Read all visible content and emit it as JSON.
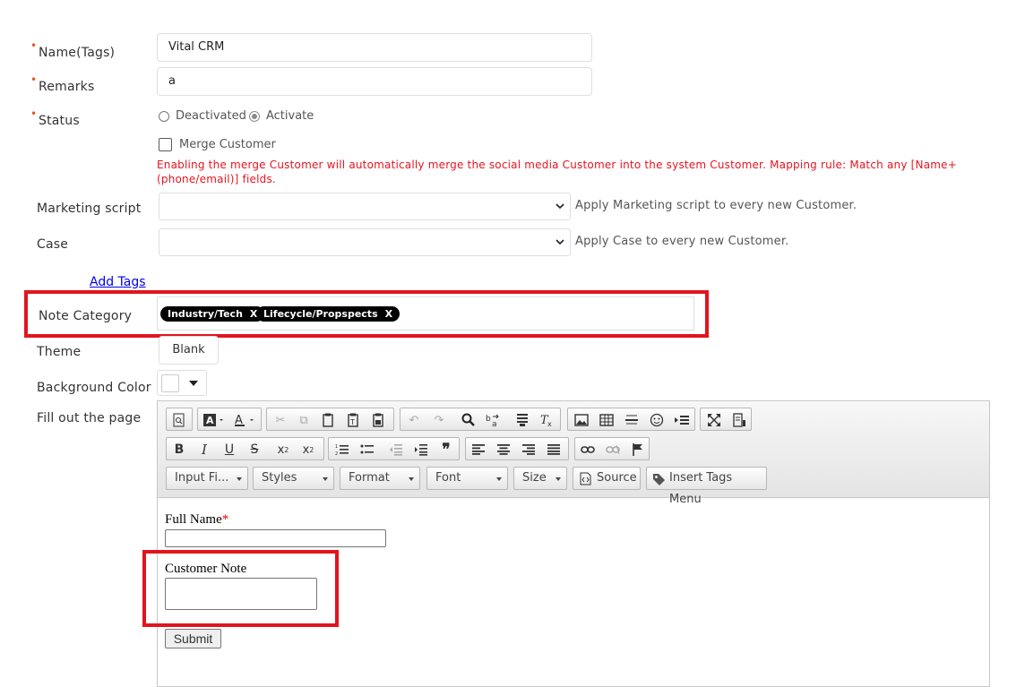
{
  "form": {
    "name_label": "Name(Tags)",
    "name_value": "Vital CRM",
    "remarks_label": "Remarks",
    "remarks_value": "a",
    "status_label": "Status",
    "status_options": [
      "Deactivated",
      "Activate"
    ],
    "status_selected": "Activate",
    "merge_label": "Merge Customer",
    "merge_warning": "Enabling the merge Customer will automatically merge the social media Customer into the system Customer. Mapping rule: Match any [Name+(phone/email)] fields.",
    "marketing_label": "Marketing script",
    "marketing_hint": "Apply Marketing script to every new Customer.",
    "case_label": "Case",
    "case_hint": "Apply Case to every new Customer.",
    "add_tags_link": "Add Tags",
    "note_category_label": "Note Category",
    "tags": [
      "Industry/Tech",
      "Lifecycle/Propspects"
    ],
    "tag_remove": "X",
    "theme_label": "Theme",
    "theme_value": "Blank",
    "bgcolor_label": "Background Color",
    "fill_label": "Fill out the page"
  },
  "editor": {
    "combos": [
      "Input Fi...",
      "Styles",
      "Format",
      "Font",
      "Size"
    ],
    "source_label": "Source",
    "insert_tags_label": "Insert Tags Menu",
    "content": {
      "full_name_label": "Full Name",
      "required_mark": "*",
      "customer_note_label": "Customer Note",
      "submit_label": "Submit"
    }
  },
  "colors": {
    "required_dot": "#e0571e",
    "warning_text": "#e8141f",
    "highlight_box": "#e1141e",
    "link": "#0000ee",
    "tag_bg": "#000000"
  }
}
